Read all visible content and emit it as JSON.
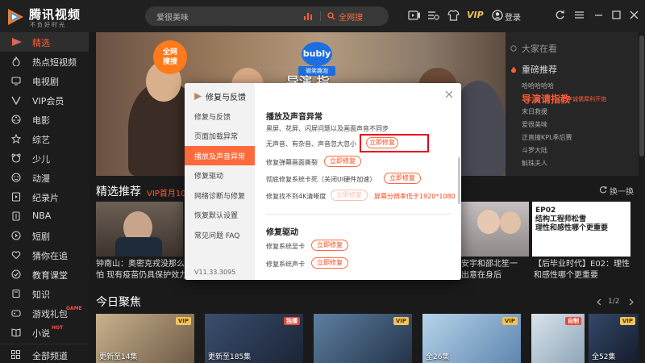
{
  "app": {
    "name": "腾讯视频",
    "slogan": "不负好时光"
  },
  "topbar": {
    "search_text": "爱很美味",
    "search_button": "全网搜",
    "vip_label": "VIP",
    "login_label": "登录"
  },
  "sidebar": {
    "items": [
      {
        "label": "精选",
        "icon": "home-icon",
        "active": true
      },
      {
        "label": "热点短视频",
        "icon": "fire-icon"
      },
      {
        "label": "电视剧",
        "icon": "tv-icon"
      },
      {
        "label": "VIP会员",
        "icon": "vip-icon"
      },
      {
        "label": "电影",
        "icon": "film-icon"
      },
      {
        "label": "综艺",
        "icon": "star-icon"
      },
      {
        "label": "少儿",
        "icon": "kid-icon"
      },
      {
        "label": "动漫",
        "icon": "anime-icon"
      },
      {
        "label": "纪录片",
        "icon": "doc-icon"
      },
      {
        "label": "NBA",
        "icon": "nba-icon"
      },
      {
        "label": "短剧",
        "icon": "short-play-icon"
      },
      {
        "label": "猜你在追",
        "icon": "heart-icon"
      },
      {
        "label": "教育课堂",
        "icon": "edu-icon"
      },
      {
        "label": "知识",
        "icon": "book-icon"
      },
      {
        "label": "游戏礼包",
        "icon": "game-icon",
        "badge": "GAME"
      },
      {
        "label": "小说",
        "icon": "novel-icon",
        "badge": "HOT"
      }
    ],
    "all_channels": "全部频道"
  },
  "banner": {
    "badge": "全网\n搜搜",
    "bubly_logo": "bubly",
    "bubly_sub": "微笑趣泡",
    "slogan": "导演 指"
  },
  "right_panel": {
    "heading1": "大家在看",
    "heading2": "重磅推荐",
    "rows_top": [
      "哈哈哈哈哈"
    ],
    "featured": "导演请指教",
    "featured_sub": "李诚儒犀利开炮",
    "rows_bottom": [
      "末日救援",
      "爱很美味",
      "正直撞KPL季后赛",
      "斗罗大陆",
      "斛珠夫人"
    ]
  },
  "section_picks": {
    "title": "精选推荐",
    "sub": "VIP首月10",
    "refresh": "换一换",
    "cards": [
      {
        "caption": "钟南山：奥密克戎没那么可\n怕 现有疫苗仍具保护效力"
      },
      {
        "caption": "安宇和邵北笙一\n出意在身后"
      },
      {
        "caption": "【后毕业时代】E02：理性\n和感性哪个更重要"
      }
    ],
    "poster_text": "EP02\n结构工程师松雪\n理性和感性哪个更重要"
  },
  "section_focus": {
    "title": "今日聚焦",
    "pager": "1/2",
    "cards": [
      {
        "tag": "VIP",
        "caption": "更新至14集"
      },
      {
        "tag": "独播",
        "caption": "更新至185集",
        "red": true
      },
      {
        "tag": "VIP",
        "caption": ""
      },
      {
        "tag": "VIP",
        "caption": "全26集"
      },
      {
        "tag": "自制",
        "caption": "",
        "red": true
      },
      {
        "tag": "VIP",
        "caption": "全52集"
      }
    ]
  },
  "dialog": {
    "title": "修复与反馈",
    "nav": [
      {
        "label": "修复与反馈"
      },
      {
        "label": "页面加载异常"
      },
      {
        "label": "播放及声音异常",
        "active": true
      },
      {
        "label": "修复驱动"
      },
      {
        "label": "网络诊断与修复"
      },
      {
        "label": "恢复默认设置"
      },
      {
        "label": "常见问题 FAQ"
      }
    ],
    "version": "V11.33.3095",
    "section1_title": "播放及声音异常",
    "section1_desc": "黑屏、花屏、闪屏问题以及画面声音不同步",
    "rows1": [
      {
        "label": "无声音、有杂音、声音忽大忽小",
        "button": "立即修复"
      },
      {
        "label": "修复弹幕画面撕裂",
        "button": "立即修复"
      },
      {
        "label": "彻底修复系统卡死（关闭UI硬件加速）",
        "button": "立即修复"
      },
      {
        "label": "修复找不到4K清晰度",
        "button": "立即修复",
        "disabled": true,
        "warning": "屏幕分辨率低于1920*1080"
      }
    ],
    "section2_title": "修复驱动",
    "rows2": [
      {
        "label": "修复系统显卡",
        "button": "立即修复"
      },
      {
        "label": "修复系统声卡",
        "button": "立即修复"
      }
    ]
  },
  "colors": {
    "accent": "#ff6a3d",
    "highlight": "#e8001c",
    "vip": "#f3c35c"
  }
}
